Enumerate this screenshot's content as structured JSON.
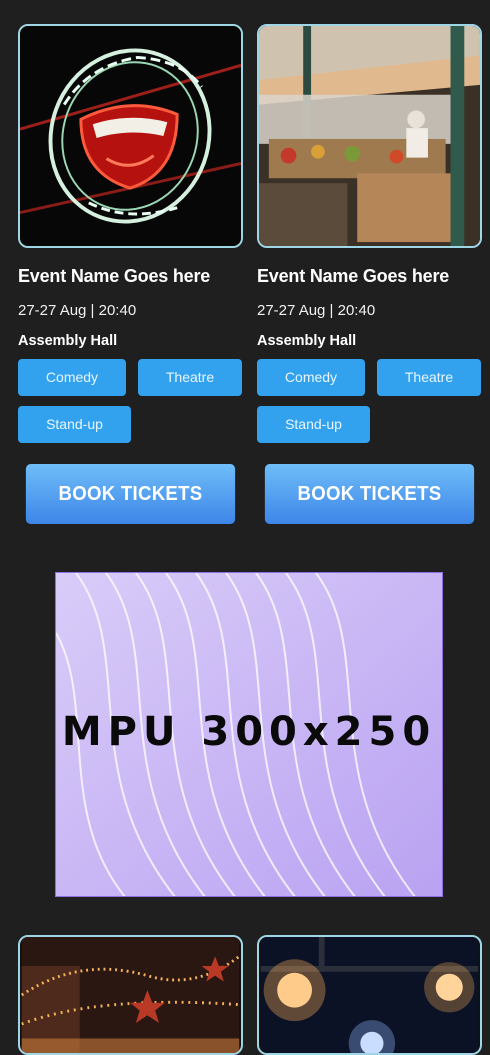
{
  "events": [
    {
      "title": "Event Name Goes here",
      "date": "27-27 Aug | 20:40",
      "venue": "Assembly Hall",
      "tags": [
        "Comedy",
        "Theatre",
        "Stand-up"
      ],
      "cta": "BOOK TICKETS",
      "image_icon": "comedy-store-neon-image"
    },
    {
      "title": "Event Name Goes here",
      "date": "27-27 Aug | 20:40",
      "venue": "Assembly Hall",
      "tags": [
        "Comedy",
        "Theatre",
        "Stand-up"
      ],
      "cta": "BOOK TICKETS",
      "image_icon": "market-stall-image"
    }
  ],
  "ad": {
    "label": "MPU 300x250"
  },
  "more_events": [
    {
      "image_icon": "festive-lights-image"
    },
    {
      "image_icon": "stage-lights-image"
    }
  ],
  "colors": {
    "background": "#1f1f20",
    "tag": "#33a2ee",
    "button_top": "#6fbdf8",
    "button_bottom": "#3d86e8",
    "thumb_border": "#9fd6e6",
    "ad_bg": "#c7b6f6"
  }
}
